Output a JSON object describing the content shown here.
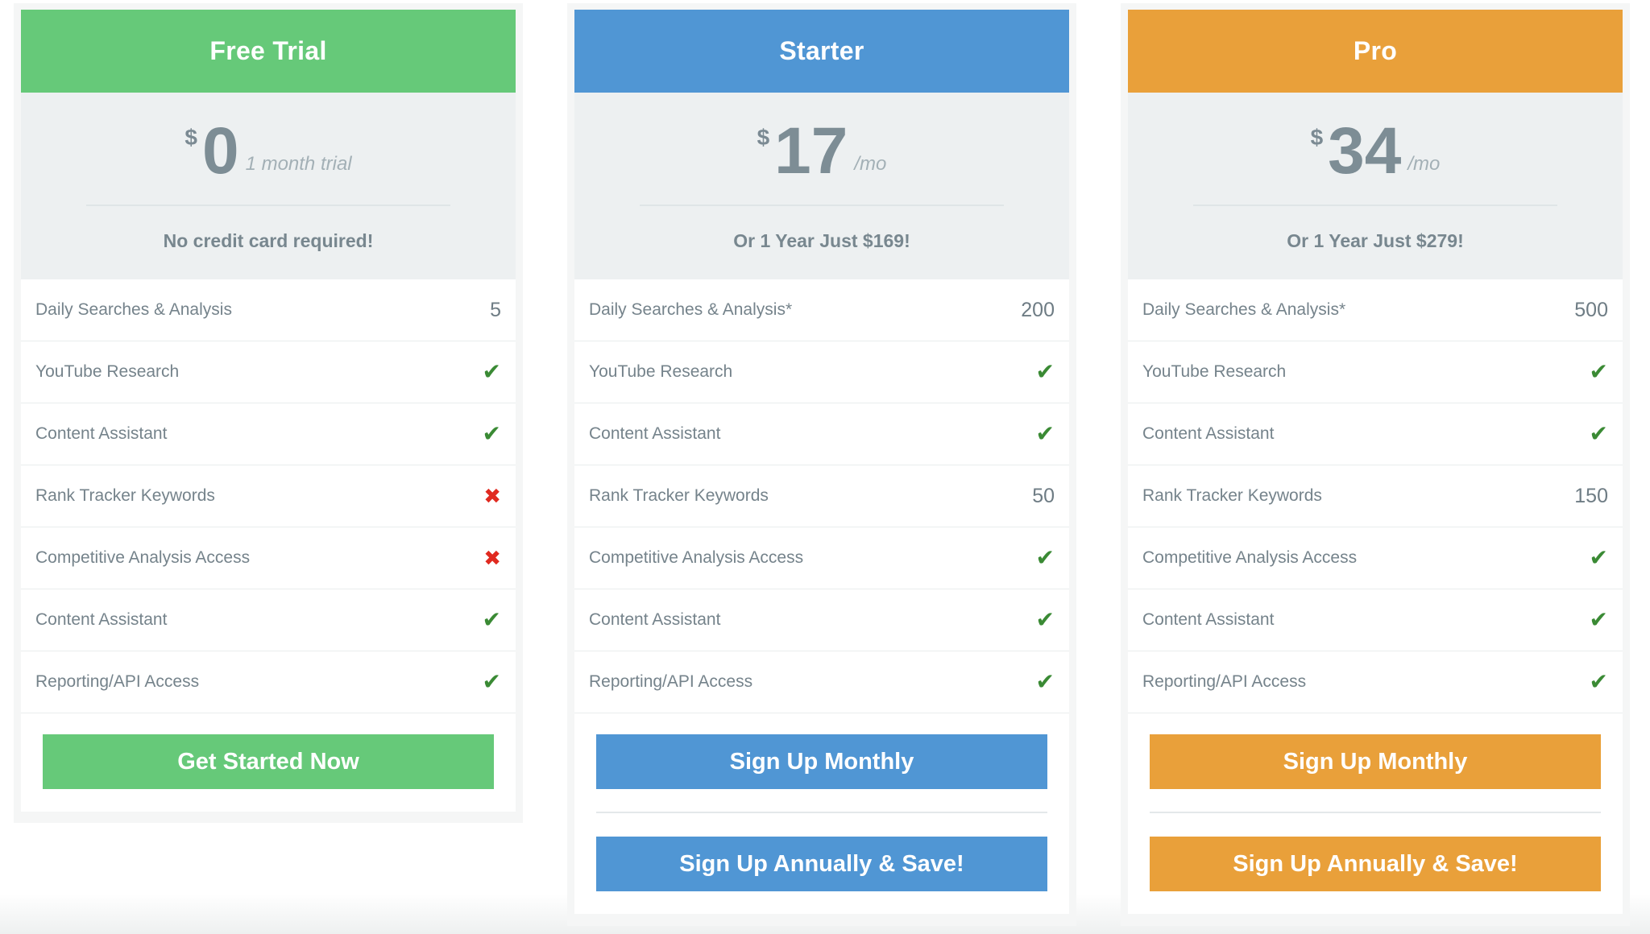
{
  "plans": [
    {
      "title": "Free Trial",
      "currency": "$",
      "amount": "0",
      "period": "1 month trial",
      "note": "No credit card required!",
      "color": "#66c979",
      "features": [
        {
          "label": "Daily Searches & Analysis",
          "value": "5"
        },
        {
          "label": "YouTube Research",
          "icon": "check-icon"
        },
        {
          "label": "Content Assistant",
          "icon": "check-icon"
        },
        {
          "label": "Rank Tracker Keywords",
          "icon": "cross-icon"
        },
        {
          "label": "Competitive Analysis Access",
          "icon": "cross-icon"
        },
        {
          "label": "Content Assistant",
          "icon": "check-icon"
        },
        {
          "label": "Reporting/API Access",
          "icon": "check-icon"
        }
      ],
      "buttons": [
        "Get Started Now"
      ]
    },
    {
      "title": "Starter",
      "currency": "$",
      "amount": "17",
      "period": "/mo",
      "note": "Or 1 Year Just $169!",
      "color": "#5096d4",
      "features": [
        {
          "label": "Daily Searches & Analysis*",
          "value": "200"
        },
        {
          "label": "YouTube Research",
          "icon": "check-icon"
        },
        {
          "label": "Content Assistant",
          "icon": "check-icon"
        },
        {
          "label": "Rank Tracker Keywords",
          "value": "50"
        },
        {
          "label": "Competitive Analysis Access",
          "icon": "check-icon"
        },
        {
          "label": "Content Assistant",
          "icon": "check-icon"
        },
        {
          "label": "Reporting/API Access",
          "icon": "check-icon"
        }
      ],
      "buttons": [
        "Sign Up Monthly",
        "Sign Up Annually & Save!"
      ]
    },
    {
      "title": "Pro",
      "currency": "$",
      "amount": "34",
      "period": "/mo",
      "note": "Or 1 Year Just $279!",
      "color": "#e9a03a",
      "features": [
        {
          "label": "Daily Searches & Analysis*",
          "value": "500"
        },
        {
          "label": "YouTube Research",
          "icon": "check-icon"
        },
        {
          "label": "Content Assistant",
          "icon": "check-icon"
        },
        {
          "label": "Rank Tracker Keywords",
          "value": "150"
        },
        {
          "label": "Competitive Analysis Access",
          "icon": "check-icon"
        },
        {
          "label": "Content Assistant",
          "icon": "check-icon"
        },
        {
          "label": "Reporting/API Access",
          "icon": "check-icon"
        }
      ],
      "buttons": [
        "Sign Up Monthly",
        "Sign Up Annually & Save!"
      ]
    }
  ]
}
